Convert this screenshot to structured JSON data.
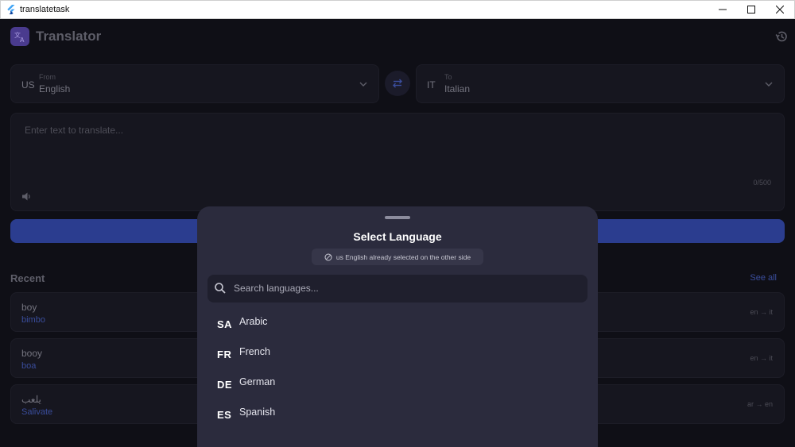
{
  "window": {
    "title": "translatetask"
  },
  "app": {
    "name": "Translator",
    "from": {
      "label": "From",
      "code": "US",
      "language": "English"
    },
    "to": {
      "label": "To",
      "code": "IT",
      "language": "Italian"
    },
    "input": {
      "placeholder": "Enter text to translate...",
      "char_count": "0/500"
    },
    "recent": {
      "title": "Recent",
      "see_all": "See all",
      "items": [
        {
          "source": "boy",
          "target": "bimbo",
          "pair": "en → it"
        },
        {
          "source": "booy",
          "target": "boa",
          "pair": "en → it"
        },
        {
          "source": "يلعب",
          "target": "Salivate",
          "pair": "ar → en"
        }
      ]
    }
  },
  "sheet": {
    "title": "Select Language",
    "notice": "us English already selected on the other side",
    "search_placeholder": "Search languages...",
    "languages": [
      {
        "code": "SA",
        "name": "Arabic"
      },
      {
        "code": "FR",
        "name": "French"
      },
      {
        "code": "DE",
        "name": "German"
      },
      {
        "code": "ES",
        "name": "Spanish"
      }
    ]
  },
  "colors": {
    "accent": "#2b3d8f",
    "sheet_bg": "#2b2b3d",
    "app_bg": "#0f0f16"
  }
}
